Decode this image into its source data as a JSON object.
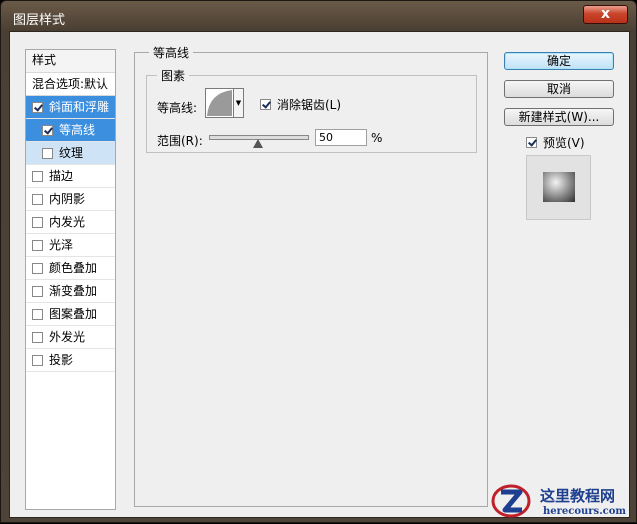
{
  "window": {
    "title": "图层样式",
    "close": "x"
  },
  "styles": {
    "header": "样式",
    "blend_options": "混合选项:默认",
    "items": [
      {
        "label": "斜面和浮雕",
        "checked": true,
        "state": "selected"
      },
      {
        "label": "等高线",
        "checked": true,
        "state": "selected",
        "sub": true
      },
      {
        "label": "纹理",
        "checked": false,
        "state": "subsel",
        "sub": true
      },
      {
        "label": "描边",
        "checked": false
      },
      {
        "label": "内阴影",
        "checked": false
      },
      {
        "label": "内发光",
        "checked": false
      },
      {
        "label": "光泽",
        "checked": false
      },
      {
        "label": "颜色叠加",
        "checked": false
      },
      {
        "label": "渐变叠加",
        "checked": false
      },
      {
        "label": "图案叠加",
        "checked": false
      },
      {
        "label": "外发光",
        "checked": false
      },
      {
        "label": "投影",
        "checked": false
      }
    ]
  },
  "contour_panel": {
    "title": "等高线",
    "group_title": "图素",
    "contour_label": "等高线:",
    "antialias_label": "消除锯齿(L)",
    "antialias_checked": true,
    "range_label": "范围(R):",
    "range_value": "50",
    "range_unit": "%",
    "range_fraction": 0.5
  },
  "buttons": {
    "ok": "确定",
    "cancel": "取消",
    "new_style": "新建样式(W)...",
    "preview": "预览(V)",
    "preview_checked": true
  },
  "watermark": {
    "name": "这里教程网",
    "url": "herecours.com"
  },
  "icons": {
    "close": "close-icon",
    "contour_curve": "contour-curve-icon",
    "dropdown": "chevron-down-icon",
    "logo": "logo-icon"
  }
}
